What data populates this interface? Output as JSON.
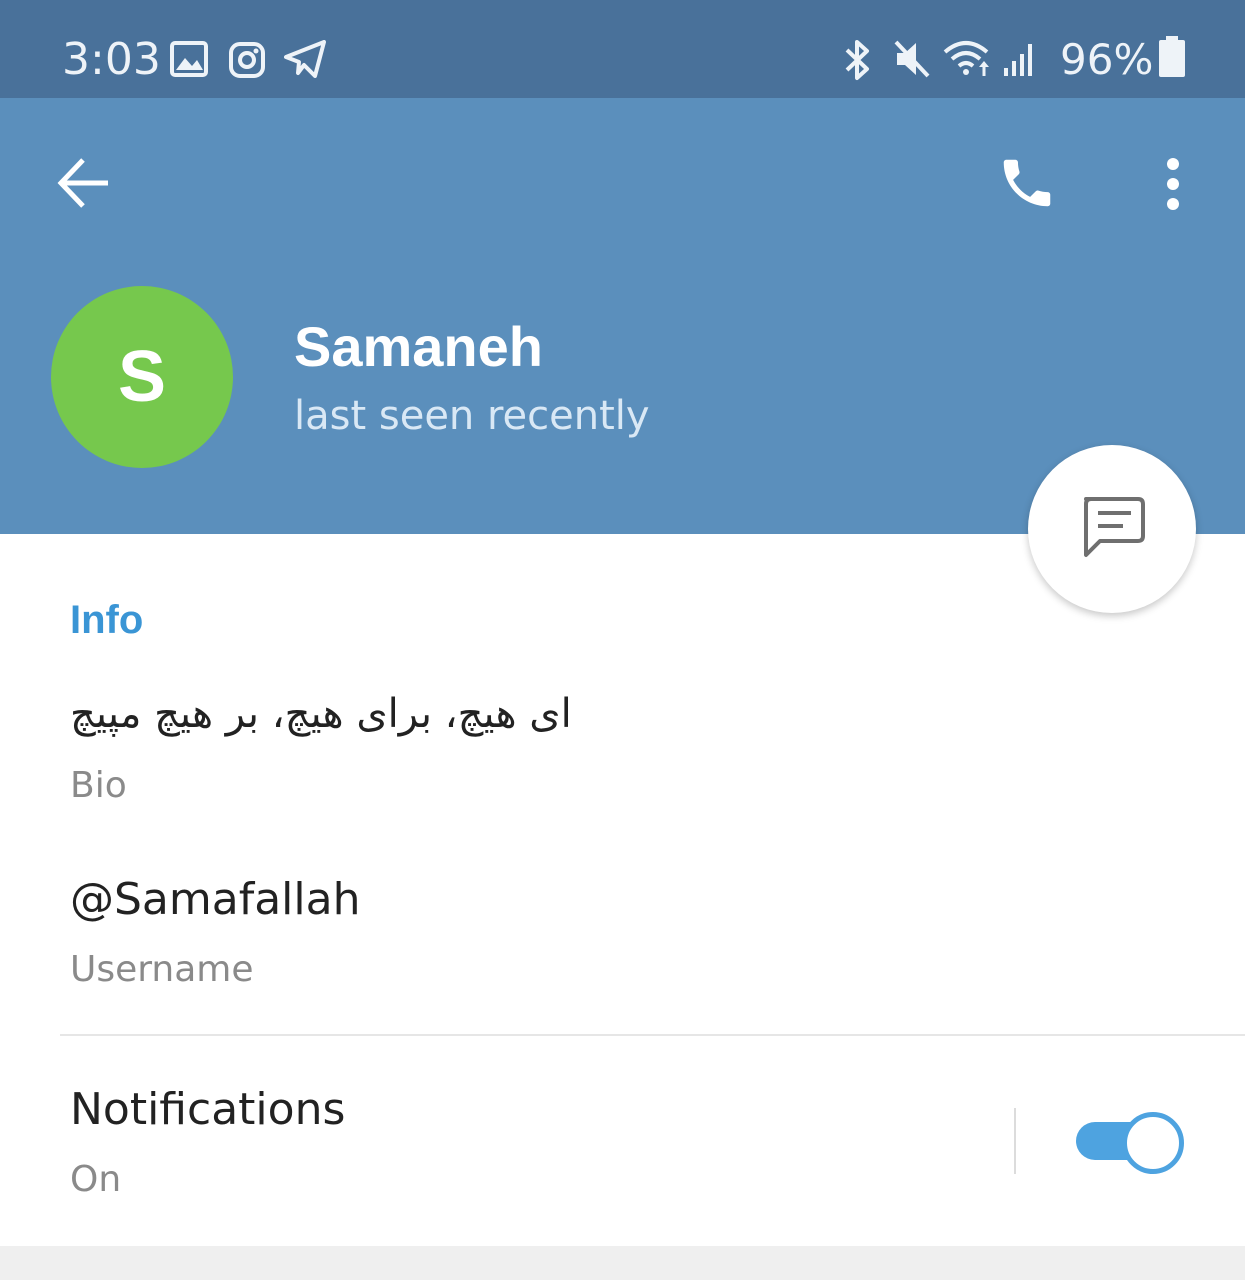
{
  "status_bar": {
    "time": "3:03",
    "battery": "96%",
    "icons": [
      "gallery-icon",
      "instagram-icon",
      "telegram-icon",
      "bluetooth-icon",
      "mute-icon",
      "wifi-icon",
      "signal-icon",
      "battery-icon"
    ]
  },
  "header": {
    "back_icon": "arrow-left-icon",
    "call_icon": "phone-icon",
    "menu_icon": "more-vertical-icon"
  },
  "profile": {
    "avatar_letter": "S",
    "name": "Samaneh",
    "status": "last seen recently"
  },
  "info": {
    "section_title": "Info",
    "bio_value": "ای هیچ، برای هیچ، بر هیچ مپیچ",
    "bio_label": "Bio",
    "username_value": "@Samafallah",
    "username_label": "Username"
  },
  "notifications": {
    "title": "Notifications",
    "state": "On",
    "enabled": true
  },
  "colors": {
    "status_bar": "#49719a",
    "header": "#5b8fbc",
    "avatar": "#76c84d",
    "accent": "#3a95d5",
    "toggle": "#4ea3e0"
  }
}
